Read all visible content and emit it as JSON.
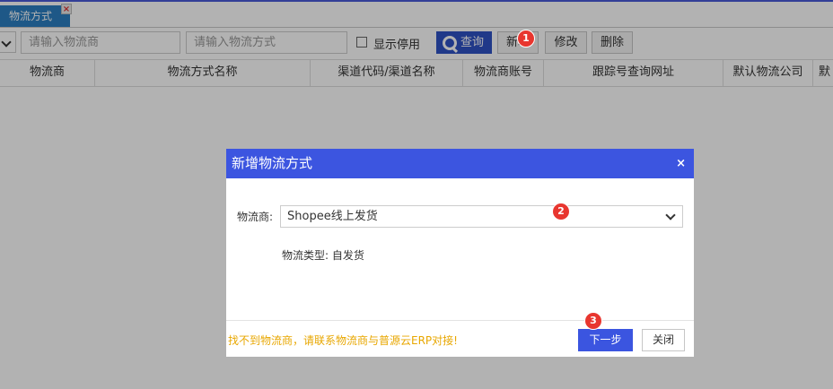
{
  "tab": {
    "label": "物流方式",
    "close_glyph": "×"
  },
  "toolbar": {
    "search_provider_placeholder": "请输入物流商",
    "search_method_placeholder": "请输入物流方式",
    "show_disabled_label": "显示停用",
    "query_label": "查询",
    "add_label": "新增",
    "edit_label": "修改",
    "delete_label": "删除"
  },
  "table": {
    "columns": [
      "物流商",
      "物流方式名称",
      "渠道代码/渠道名称",
      "物流商账号",
      "跟踪号查询网址",
      "默认物流公司",
      "默"
    ]
  },
  "badges": {
    "b1": "1",
    "b2": "2",
    "b3": "3"
  },
  "dialog": {
    "title": "新增物流方式",
    "close_glyph": "×",
    "provider_label": "物流商:",
    "provider_value": "Shopee线上发货",
    "type_label": "物流类型:",
    "type_value": "自发货",
    "footer_note": "找不到物流商，请联系物流商与普源云ERP对接!",
    "next_label": "下一步",
    "close_label": "关闭"
  },
  "colors": {
    "accent": "#3c55e0",
    "tab": "#2c7fc2",
    "badge": "#e8362f",
    "note": "#e8a700"
  }
}
